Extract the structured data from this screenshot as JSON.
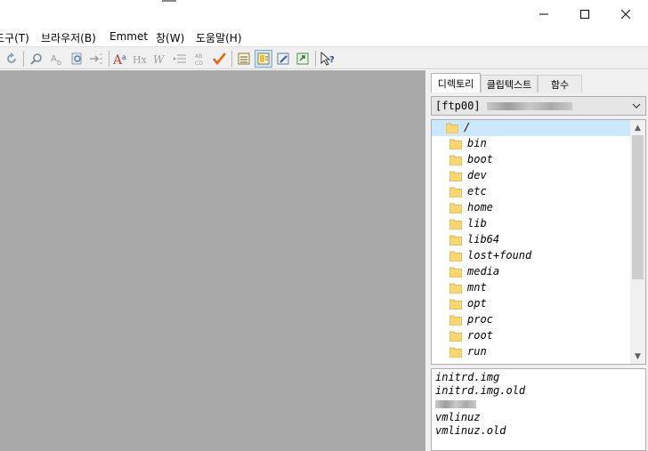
{
  "window": {
    "controls": {
      "minimize_icon": "minimize-icon",
      "maximize_icon": "maximize-icon",
      "close_icon": "close-icon"
    }
  },
  "menu": [
    {
      "label": "도구(T)"
    },
    {
      "label": "브라우저(B)"
    },
    {
      "label": "Emmet"
    },
    {
      "label": "창(W)"
    },
    {
      "label": "도움말(H)"
    }
  ],
  "toolbar": {
    "buttons": [
      "redo-icon",
      "find-icon",
      "replace-icon",
      "find-in-files-icon",
      "goto-icon",
      "font-size-icon",
      "heading-icon",
      "italic-w-icon",
      "indent-icon",
      "sort-icon",
      "spellcheck-icon",
      "outline-panel-icon",
      "file-panel-icon",
      "notes-panel-icon",
      "output-panel-icon",
      "help-pointer-icon"
    ]
  },
  "panel": {
    "tabs": [
      {
        "label": "디렉토리",
        "active": true
      },
      {
        "label": "클립텍스트",
        "active": false
      },
      {
        "label": "함수",
        "active": false
      }
    ],
    "server": {
      "label": "[ftp00]"
    },
    "tree": [
      {
        "name": "/",
        "selected": true
      },
      {
        "name": "bin"
      },
      {
        "name": "boot"
      },
      {
        "name": "dev"
      },
      {
        "name": "etc"
      },
      {
        "name": "home"
      },
      {
        "name": "lib"
      },
      {
        "name": "lib64"
      },
      {
        "name": "lost+found"
      },
      {
        "name": "media"
      },
      {
        "name": "mnt"
      },
      {
        "name": "opt"
      },
      {
        "name": "proc"
      },
      {
        "name": "root"
      },
      {
        "name": "run"
      }
    ],
    "files": [
      {
        "name": "initrd.img"
      },
      {
        "name": "initrd.img.old"
      },
      {
        "name": "",
        "redacted": true
      },
      {
        "name": "vmlinuz"
      },
      {
        "name": "vmlinuz.old"
      }
    ]
  },
  "colors": {
    "editor_bg": "#a9a9a9",
    "selection": "#cce8ff",
    "folder": "#f7d774"
  }
}
